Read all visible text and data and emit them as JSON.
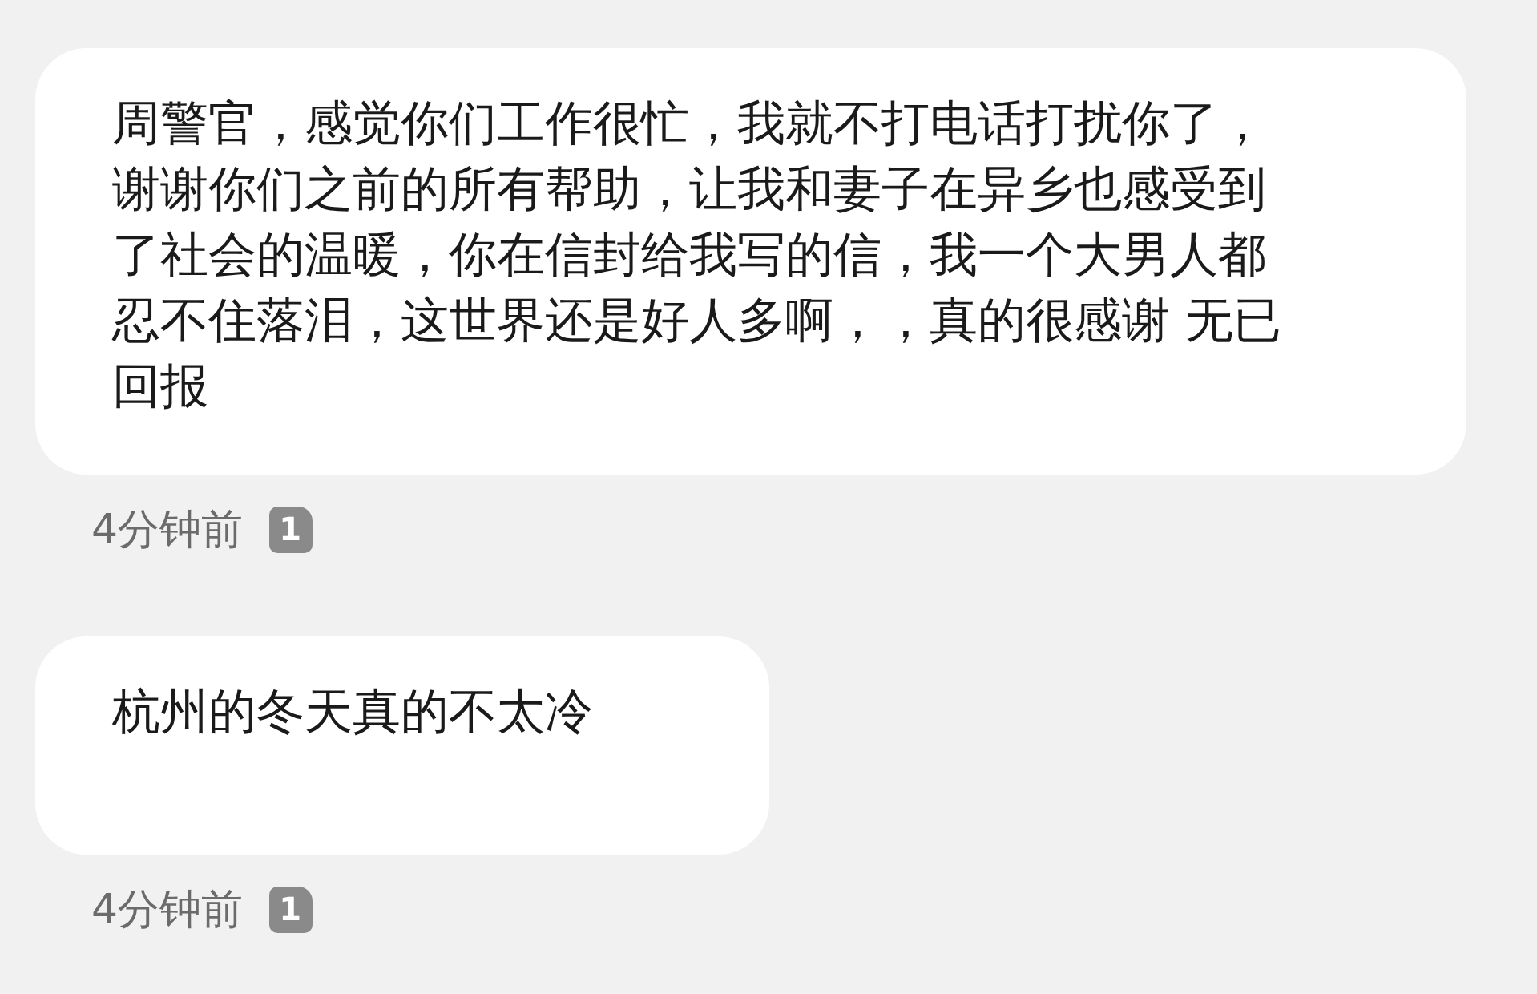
{
  "messages": [
    {
      "text": "周警官，感觉你们工作很忙，我就不打电话打扰你了，谢谢你们之前的所有帮助，让我和妻子在异乡也感受到了社会的温暖，你在信封给我写的信，我一个大男人都忍不住落泪，这世界还是好人多啊，，真的很感谢 无已回报",
      "time": "4分钟前",
      "badge": "1"
    },
    {
      "text": "杭州的冬天真的不太冷",
      "time": "4分钟前",
      "badge": "1"
    }
  ]
}
